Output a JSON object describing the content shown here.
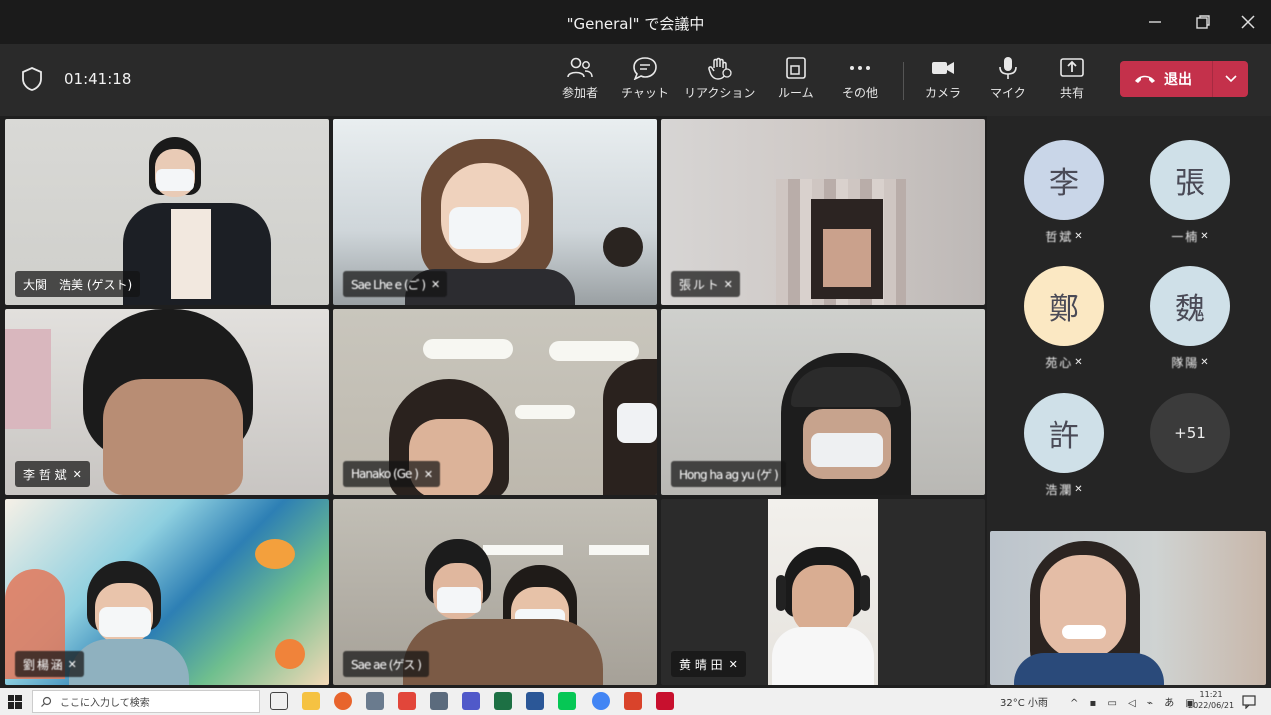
{
  "window": {
    "title": "\"General\" で会議中"
  },
  "toolbar": {
    "timer": "01:41:18",
    "participants": "参加者",
    "chat": "チャット",
    "reaction": "リアクション",
    "room": "ルーム",
    "more": "その他",
    "camera": "カメラ",
    "mic": "マイク",
    "share": "共有",
    "leave": "退出"
  },
  "tiles": [
    {
      "name": "大関　浩美 (ゲスト)"
    },
    {
      "name": "Sae  Lhe e  (ご   )"
    },
    {
      "name": "張 ル ト"
    },
    {
      "name": "李 哲 斌"
    },
    {
      "name": "Hanako  (Ge  )"
    },
    {
      "name": "Hong  ha  ag  yu  (ゲ )"
    },
    {
      "name": "劉 楊 涵"
    },
    {
      "name": "Sae  ae  (ゲス )"
    },
    {
      "name": "黄 晴 田"
    }
  ],
  "roster": [
    {
      "initial": "李",
      "name": "哲 斌",
      "color": "#c9d6e8"
    },
    {
      "initial": "張",
      "name": "一 楠",
      "color": "#cfe0e8"
    },
    {
      "initial": "鄭",
      "name": "苑 心",
      "color": "#fbe8c3"
    },
    {
      "initial": "魏",
      "name": "隊 陽",
      "color": "#cfe0e8"
    },
    {
      "initial": "許",
      "name": "浩 瀾",
      "color": "#cfe0e8"
    },
    {
      "initial": "+51",
      "name": "",
      "color": "#3b3b3b"
    }
  ],
  "taskbar": {
    "search_placeholder": "ここに入力して検索",
    "weather": "32°C 小雨",
    "time": "11:21",
    "date": "2022/06/21"
  },
  "colors": {
    "leave": "#c4314b",
    "bg": "#1f1f1f",
    "toolbar": "#2a2a2a"
  }
}
